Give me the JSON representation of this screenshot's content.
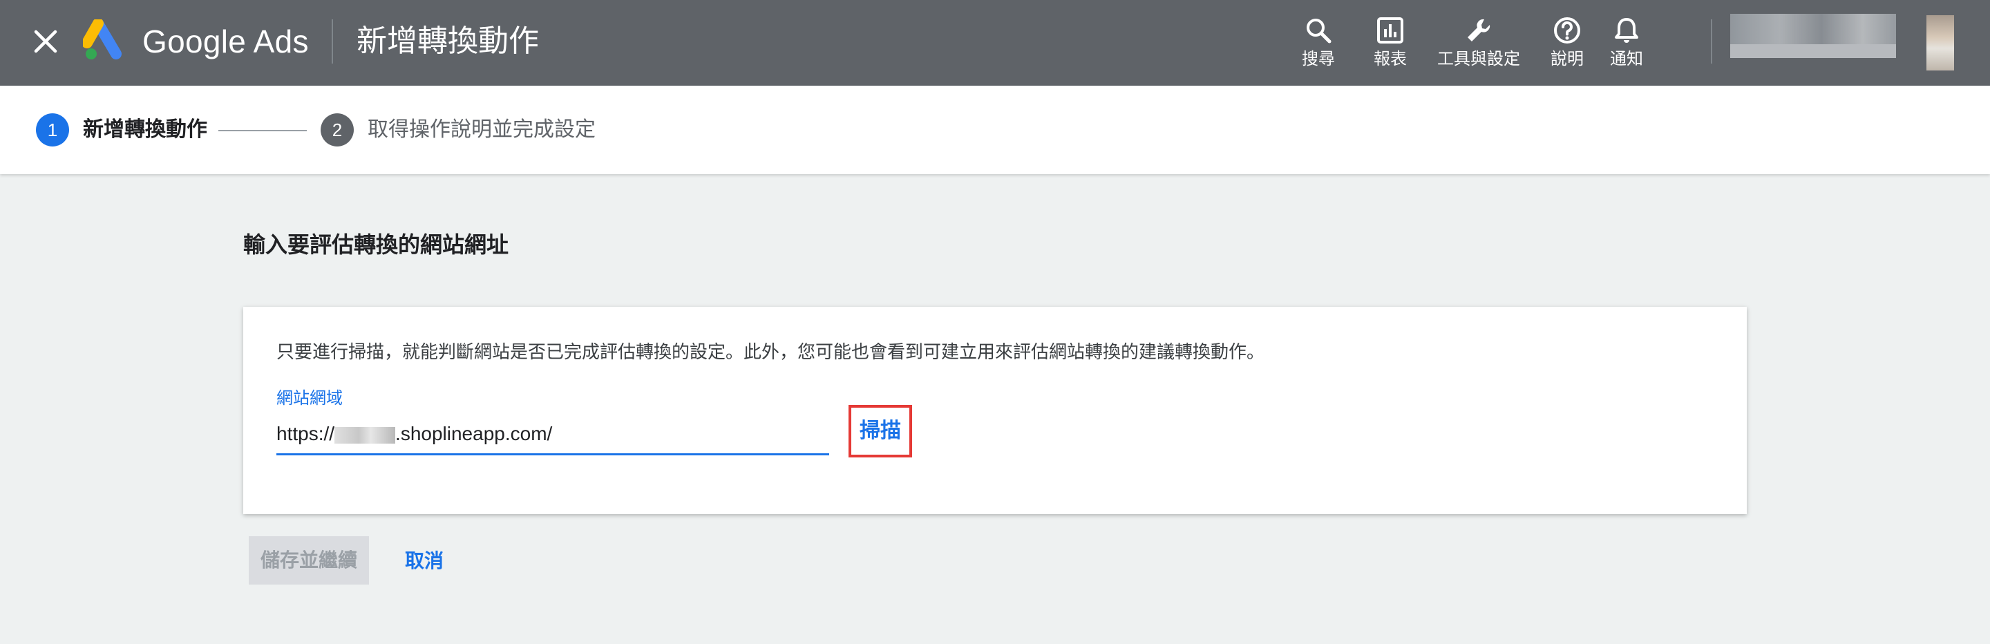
{
  "app": {
    "logo_text": "Google Ads",
    "page_title": "新增轉換動作"
  },
  "toolbar": {
    "items": [
      {
        "label": "搜尋",
        "icon": "search-icon"
      },
      {
        "label": "報表",
        "icon": "reports-icon"
      },
      {
        "label": "工具與設定",
        "icon": "wrench-icon"
      },
      {
        "label": "說明",
        "icon": "help-icon"
      },
      {
        "label": "通知",
        "icon": "bell-icon"
      }
    ]
  },
  "stepper": {
    "steps": [
      {
        "number": "1",
        "label": "新增轉換動作",
        "state": "active"
      },
      {
        "number": "2",
        "label": "取得操作說明並完成設定",
        "state": "inactive"
      }
    ]
  },
  "main": {
    "heading": "輸入要評估轉換的網站網址",
    "card": {
      "description": "只要進行掃描，就能判斷網站是否已完成評估轉換的設定。此外，您可能也會看到可建立用來評估網站轉換的建議轉換動作。",
      "field_label": "網站網域",
      "url_prefix": "https://",
      "url_suffix": ".shoplineapp.com/",
      "scan_label": "掃描"
    },
    "actions": {
      "save_label": "儲存並繼續",
      "cancel_label": "取消"
    }
  },
  "colors": {
    "topbar": "#5f6368",
    "accent": "#1a73e8",
    "highlight": "#e53935",
    "background": "#eef1f1"
  }
}
